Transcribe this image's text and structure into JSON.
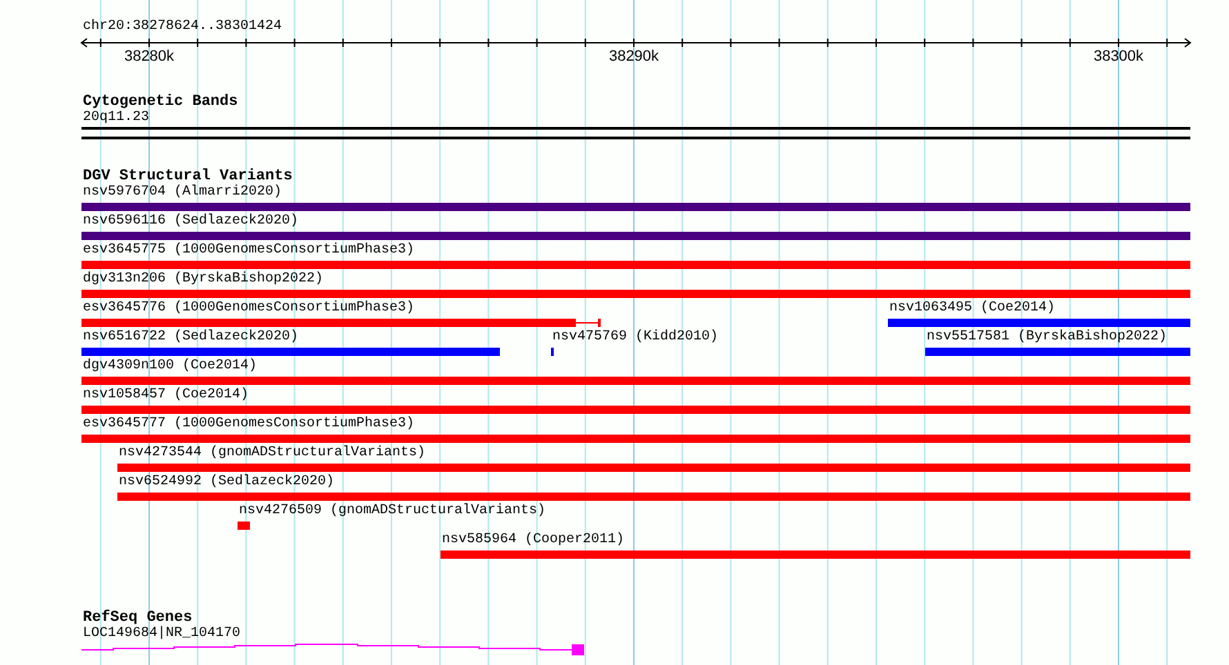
{
  "ruler": {
    "title": "chr20:38278624..38301424",
    "ticks": [
      "38280k",
      "38290k",
      "38300k"
    ]
  },
  "tracks": [
    {
      "title": "Cytogenetic Bands",
      "kind": "band",
      "features": [
        {
          "label": "20q11.23"
        }
      ]
    },
    {
      "title": "DGV Structural Variants",
      "kind": "variants",
      "features": [
        {
          "label": "nsv5976704 (Almarri2020)",
          "color": "#4b0082"
        },
        {
          "label": "nsv6596116 (Sedlazeck2020)",
          "color": "#4b0082"
        },
        {
          "label": "esv3645775 (1000GenomesConsortiumPhase3)",
          "color": "#ff0000"
        },
        {
          "label": "dgv313n206 (ByrskaBishop2022)",
          "color": "#ff0000"
        },
        {
          "label": "esv3645776 (1000GenomesConsortiumPhase3)",
          "color": "#ff0000"
        },
        {
          "label": "nsv1063495 (Coe2014)",
          "color": "#0000ff"
        },
        {
          "label": "nsv6516722 (Sedlazeck2020)",
          "color": "#0000ff"
        },
        {
          "label": "nsv475769 (Kidd2010)",
          "color": "#0000ff"
        },
        {
          "label": "nsv5517581 (ByrskaBishop2022)",
          "color": "#0000ff"
        },
        {
          "label": "dgv4309n100 (Coe2014)",
          "color": "#ff0000"
        },
        {
          "label": "nsv1058457 (Coe2014)",
          "color": "#ff0000"
        },
        {
          "label": "esv3645777 (1000GenomesConsortiumPhase3)",
          "color": "#ff0000"
        },
        {
          "label": "nsv4273544 (gnomADStructuralVariants)",
          "color": "#ff0000"
        },
        {
          "label": "nsv6524992 (Sedlazeck2020)",
          "color": "#ff0000"
        },
        {
          "label": "nsv4276509 (gnomADStructuralVariants)",
          "color": "#ff0000"
        },
        {
          "label": "nsv585964 (Cooper2011)",
          "color": "#ff0000"
        }
      ]
    },
    {
      "title": "RefSeq Genes",
      "kind": "gene",
      "features": [
        {
          "label": "LOC149684|NR_104170",
          "color": "#ff00ff"
        }
      ]
    }
  ]
}
